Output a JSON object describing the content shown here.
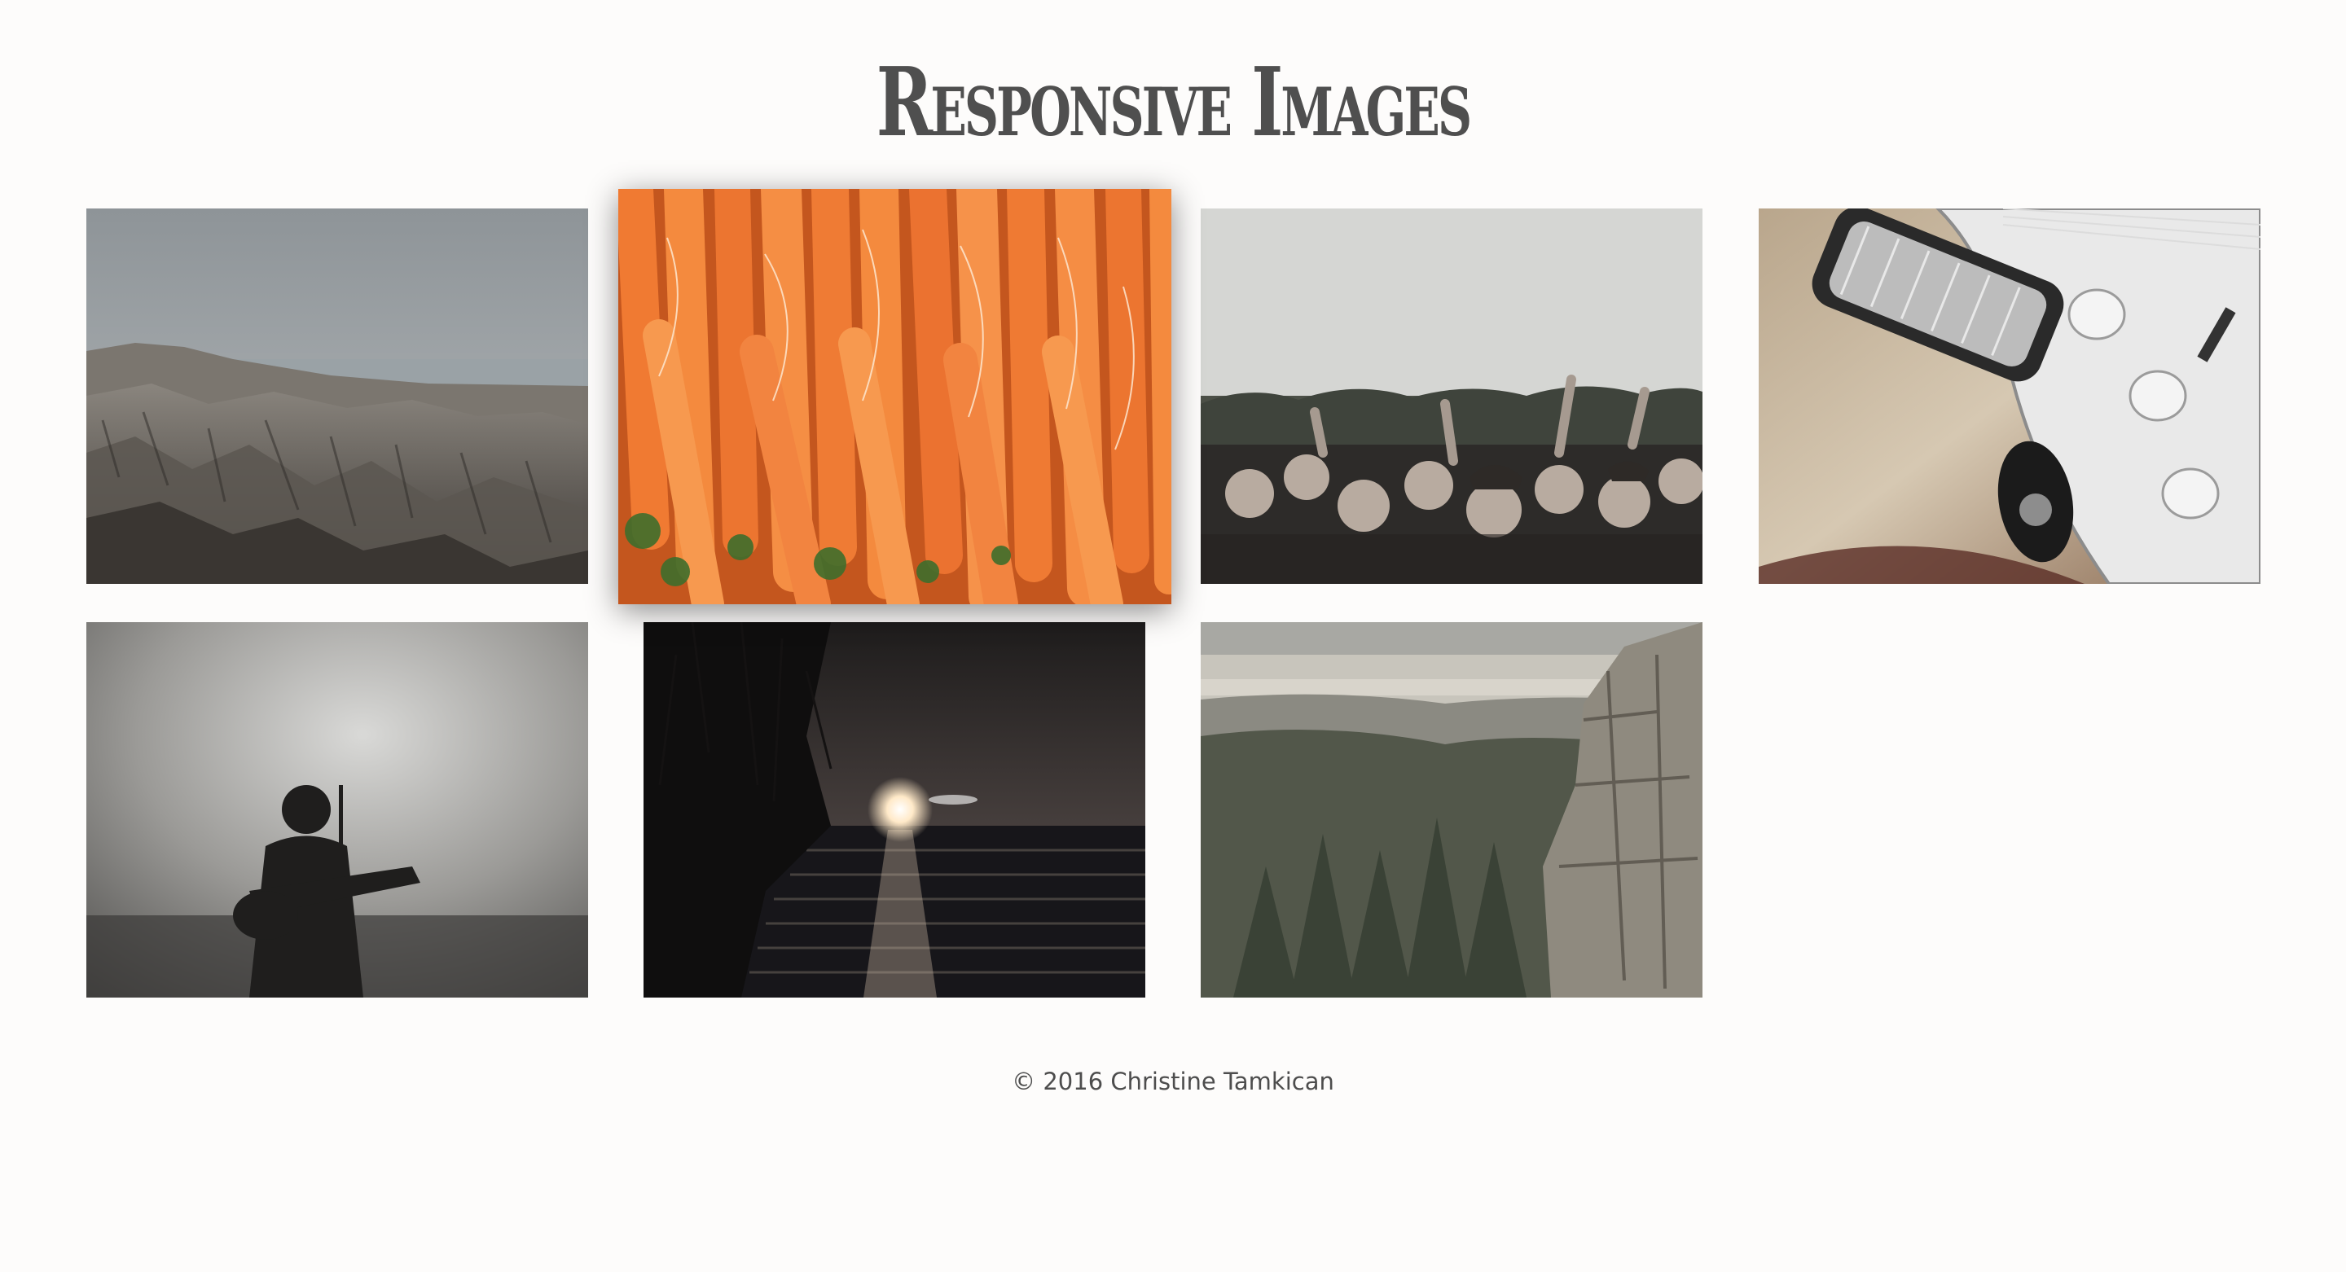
{
  "header": {
    "title": "Responsive Images"
  },
  "gallery": {
    "images": [
      {
        "subject": "rocky badlands landscape overlooking the sea",
        "focused": false
      },
      {
        "subject": "bunch of fresh orange carrots",
        "focused": true
      },
      {
        "subject": "crowd of fans at a concert",
        "focused": false
      },
      {
        "subject": "electric guitar body with knobs and bridge",
        "focused": false
      },
      {
        "subject": "silhouette of a guitarist in stage fog",
        "focused": false
      },
      {
        "subject": "sunset over a lake with bare trees",
        "focused": false
      },
      {
        "subject": "forested cliff overlooking farmland",
        "focused": false
      }
    ]
  },
  "footer": {
    "copyright": "© 2016 Christine Tamkican"
  },
  "colors": {
    "background": "#fdfcfb",
    "title": "#4f4f4f",
    "text": "#4d4d4d",
    "carrot_orange": "#f07a32"
  }
}
